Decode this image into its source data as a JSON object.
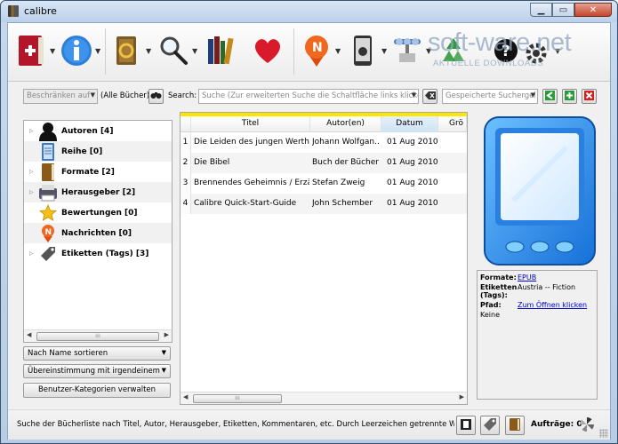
{
  "window": {
    "title": "calibre"
  },
  "watermark": {
    "brand": "soft-ware.net",
    "tagline": "AKTUELLE DOWNLOADS"
  },
  "search": {
    "restrict_placeholder": "Beschränken auf",
    "all_books": "(Alle Bücher)",
    "label": "Search:",
    "placeholder": "Suche (Zur erweiterten Suche die Schaltfläche links klicken)",
    "saved_placeholder": "Gespeicherte Suchergel"
  },
  "tag_browser": {
    "items": [
      {
        "label": "Autoren [4]",
        "icon": "user-icon"
      },
      {
        "label": "Reihe [0]",
        "icon": "series-icon"
      },
      {
        "label": "Formate [2]",
        "icon": "book-icon"
      },
      {
        "label": "Herausgeber [2]",
        "icon": "publisher-icon"
      },
      {
        "label": "Bewertungen [0]",
        "icon": "star-icon"
      },
      {
        "label": "Nachrichten [0]",
        "icon": "news-icon"
      },
      {
        "label": "Etiketten (Tags) [3]",
        "icon": "tag-icon"
      }
    ],
    "sort_by": "Nach Name sortieren",
    "match": "Übereinstimmung mit irgendeinem",
    "manage_button": "Benutzer-Kategorien verwalten"
  },
  "book_table": {
    "columns": [
      "Titel",
      "Autor(en)",
      "Datum",
      "Grö"
    ],
    "sorted_column": "Datum",
    "rows": [
      {
        "num": "1",
        "title": "Die Leiden des jungen Werther",
        "author": "Johann Wolfgan...",
        "date": "01 Aug 2010"
      },
      {
        "num": "2",
        "title": "Die Bibel",
        "author": "Buch der Bücher",
        "date": "01 Aug 2010"
      },
      {
        "num": "3",
        "title": "Brennendes Geheimnis / Erzä...",
        "author": "Stefan Zweig",
        "date": "01 Aug 2010"
      },
      {
        "num": "4",
        "title": "Calibre Quick-Start-Guide",
        "author": "John Schember",
        "date": "01 Aug 2010"
      }
    ]
  },
  "details": {
    "formats_label": "Formate:",
    "formats_value": "EPUB",
    "tags_label": "Etiketten (Tags):",
    "tags_value": "Austria -- Fiction",
    "path_label": "Pfad:",
    "path_value": "Zum Öffnen klicken",
    "extra": "Keine"
  },
  "status": {
    "text": "Suche der Bücherliste nach Titel, Autor, Herausgeber, Etiketten, Kommentaren, etc.  Durch Leerzeichen getrennte Wörter",
    "jobs": "Aufträge: 0"
  },
  "colors": {
    "accent_yellow": "#ffe600",
    "link": "#0000cc",
    "selected_header": "#cde3f4"
  }
}
